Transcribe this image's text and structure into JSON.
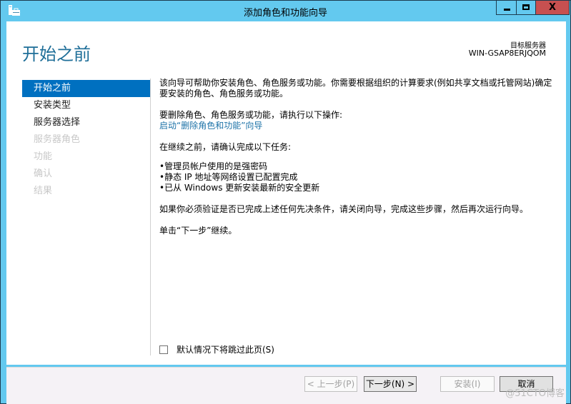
{
  "window": {
    "title": "添加角色和功能向导",
    "controls": {
      "minimize": "minimize",
      "maximize": "maximize",
      "close": "X"
    }
  },
  "header": {
    "page_title": "开始之前",
    "target_server_label": "目标服务器",
    "target_server_name": "WIN-GSAP8ERJQOM"
  },
  "sidebar": {
    "items": [
      {
        "label": "开始之前",
        "state": "active"
      },
      {
        "label": "安装类型",
        "state": "enabled"
      },
      {
        "label": "服务器选择",
        "state": "enabled"
      },
      {
        "label": "服务器角色",
        "state": "disabled"
      },
      {
        "label": "功能",
        "state": "disabled"
      },
      {
        "label": "确认",
        "state": "disabled"
      },
      {
        "label": "结果",
        "state": "disabled"
      }
    ]
  },
  "content": {
    "intro": "该向导可帮助你安装角色、角色服务或功能。你需要根据组织的计算要求(例如共享文档或托管网站)确定要安装的角色、角色服务或功能。",
    "remove_prompt": "要删除角色、角色服务或功能，请执行以下操作:",
    "remove_link": "启动“删除角色和功能”向导",
    "confirm_prompt": "在继续之前，请确认完成以下任务:",
    "tasks": [
      "管理员帐户使用的是强密码",
      "静态 IP 地址等网络设置已配置完成",
      "已从 Windows 更新安装最新的安全更新"
    ],
    "verify_note": "如果你必须验证是否已完成上述任何先决条件，请关闭向导，完成这些步骤，然后再次运行向导。",
    "continue_note": "单击“下一步”继续。"
  },
  "skip_checkbox": {
    "label": "默认情况下将跳过此页(S)",
    "checked": false
  },
  "buttons": {
    "previous": "< 上一步(P)",
    "next": "下一步(N) >",
    "install": "安装(I)",
    "cancel": "取消"
  },
  "watermark": "@51CTO博客",
  "colors": {
    "titlebar": "#63c9ef",
    "close_button": "#c75050",
    "accent": "#0070c0",
    "heading": "#1e6e98",
    "link": "#1e73a8"
  }
}
